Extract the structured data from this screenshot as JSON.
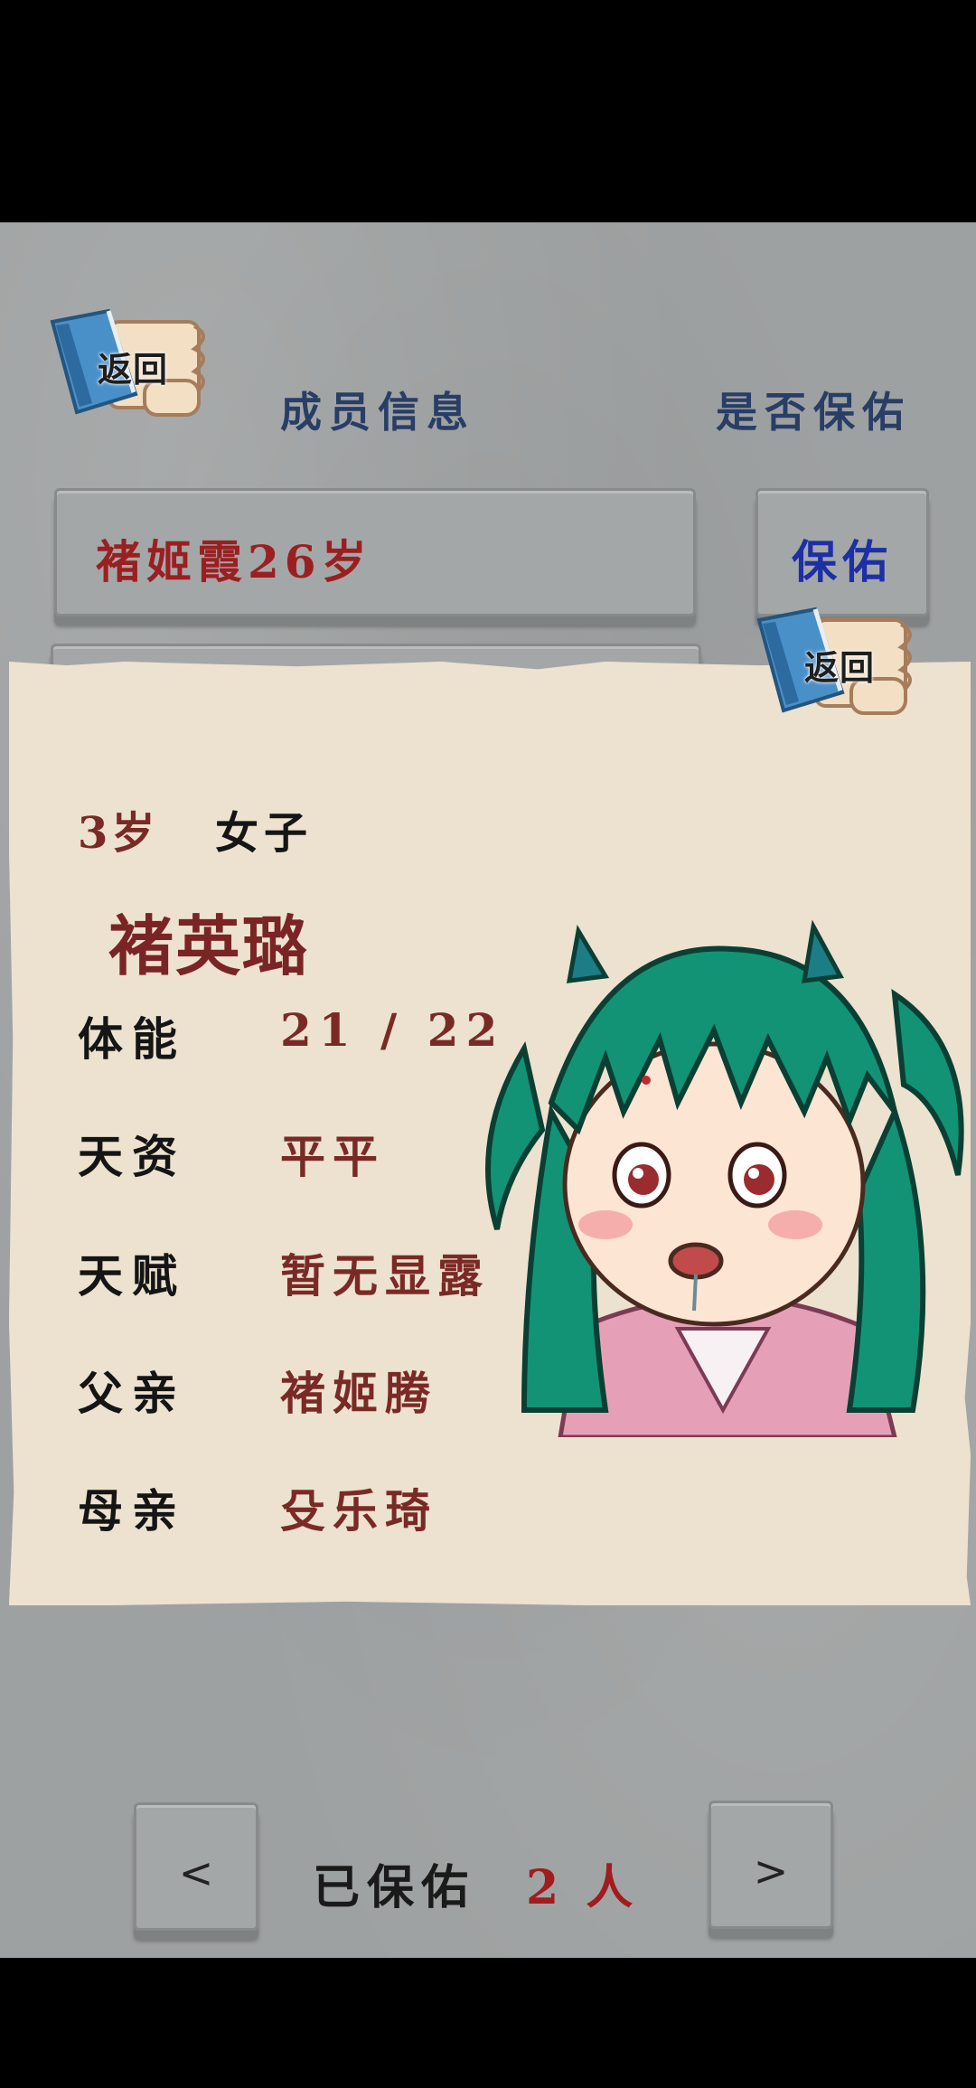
{
  "header": {
    "back_label": "返回",
    "title": "成员信息",
    "right_title": "是否保佑"
  },
  "member_row": {
    "name_age": "褚姬霞26岁",
    "protect_label": "保佑"
  },
  "detail": {
    "back_label": "返回",
    "age": "3岁",
    "gender": "女子",
    "name": "褚英璐",
    "rows": [
      {
        "label": "体能",
        "value": "21 / 22"
      },
      {
        "label": "天资",
        "value": "平平"
      },
      {
        "label": "天赋",
        "value": "暂无显露"
      },
      {
        "label": "父亲",
        "value": "褚姬腾"
      },
      {
        "label": "母亲",
        "value": "殳乐琦"
      }
    ]
  },
  "footer": {
    "prev_label": "<",
    "next_label": ">",
    "protected_label": "已保佑",
    "count": "2",
    "unit": "人"
  },
  "colors": {
    "header_blue": "#283e66",
    "name_red": "#9b1f21",
    "protect_blue": "#1d2fa5",
    "panel_bg": "#ece2cf"
  },
  "icons": [
    "book-scroll-icon",
    "character-portrait"
  ]
}
